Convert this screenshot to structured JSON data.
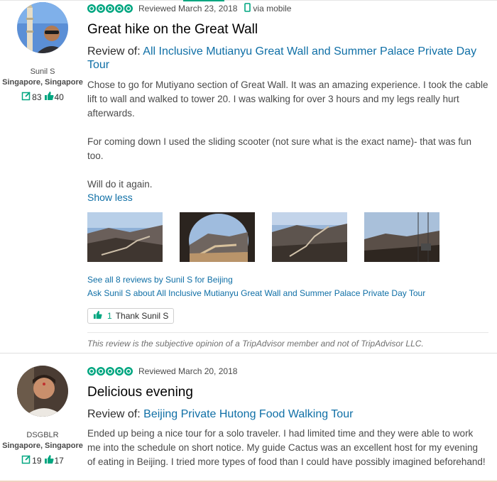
{
  "reviews": [
    {
      "reviewer": {
        "name": "Sunil S",
        "location": "Singapore, Singapore",
        "reviews_count": "83",
        "helpful_votes": "40"
      },
      "rating": 5,
      "date": "Reviewed March 23, 2018",
      "via": "via mobile",
      "title": "Great hike on the Great Wall",
      "review_of_label": "Review of:",
      "review_of_link": "All Inclusive Mutianyu Great Wall and Summer Palace Private Day Tour",
      "paragraphs": [
        "Chose to go for Mutiyano section of Great Wall. It was an amazing experience. I took the cable lift to wall and walked to tower 20. I was walking for over 3 hours and my legs really hurt afterwards.",
        "For coming down I used the sliding scooter (not sure what is the exact name)- that was fun too.",
        "Will do it again."
      ],
      "show_less": "Show less",
      "see_all": "See all 8 reviews by Sunil S for Beijing",
      "ask": "Ask Sunil S about All Inclusive Mutianyu Great Wall and Summer Palace Private Day Tour",
      "thank_count": "1",
      "thank_label": "Thank Sunil S",
      "disclaimer": "This review is the subjective opinion of a TripAdvisor member and not of TripAdvisor LLC."
    },
    {
      "reviewer": {
        "name": "DSGBLR",
        "location": "Singapore, Singapore",
        "reviews_count": "19",
        "helpful_votes": "17"
      },
      "rating": 5,
      "date": "Reviewed March 20, 2018",
      "title": "Delicious evening",
      "review_of_label": "Review of:",
      "review_of_link": "Beijing Private Hutong Food Walking Tour",
      "text": "Ended up being a nice tour for a solo traveler. I had limited time and they were able to work me into the schedule on short notice. My guide Cactus was an excellent host for my evening of eating in Beijing. I tried more types of food than I could have possibly imagined beforehand!"
    }
  ],
  "colors": {
    "accent": "#00a680",
    "link": "#0f6fa6"
  }
}
